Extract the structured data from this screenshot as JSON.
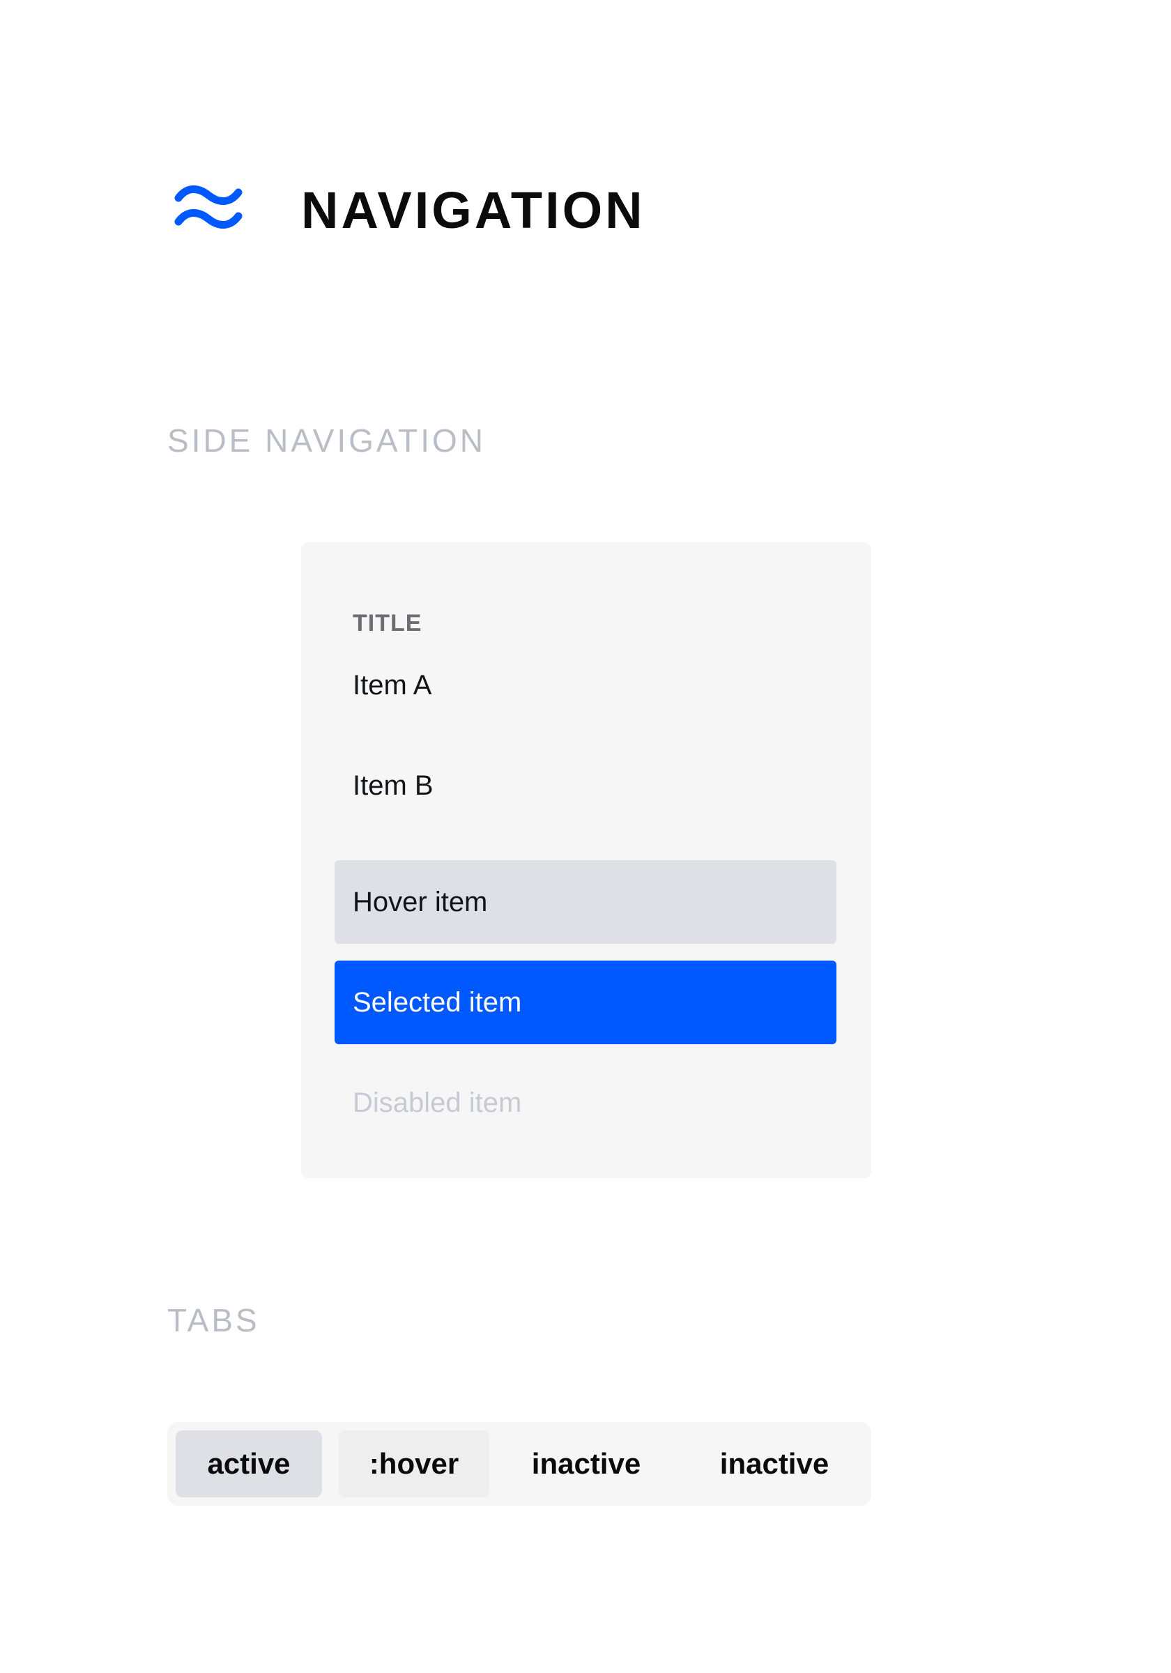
{
  "header": {
    "title": "NAVIGATION",
    "icon": "wave-icon",
    "accent_color": "#0059ff"
  },
  "sections": {
    "side_navigation_heading": "SIDE NAVIGATION",
    "tabs_heading": "TABS"
  },
  "side_nav": {
    "title": "TITLE",
    "items": [
      {
        "label": "Item A",
        "state": "default"
      },
      {
        "label": "Item B",
        "state": "default"
      },
      {
        "label": "Hover item",
        "state": "hover",
        "background": "#dee0e6"
      },
      {
        "label": "Selected item",
        "state": "selected",
        "background": "#0059ff"
      },
      {
        "label": "Disabled item",
        "state": "disabled",
        "color": "#c5cad3"
      }
    ]
  },
  "tabs": {
    "items": [
      {
        "label": "active",
        "state": "active"
      },
      {
        "label": ":hover",
        "state": "hover"
      },
      {
        "label": "inactive",
        "state": "inactive"
      },
      {
        "label": "inactive",
        "state": "inactive"
      }
    ]
  }
}
